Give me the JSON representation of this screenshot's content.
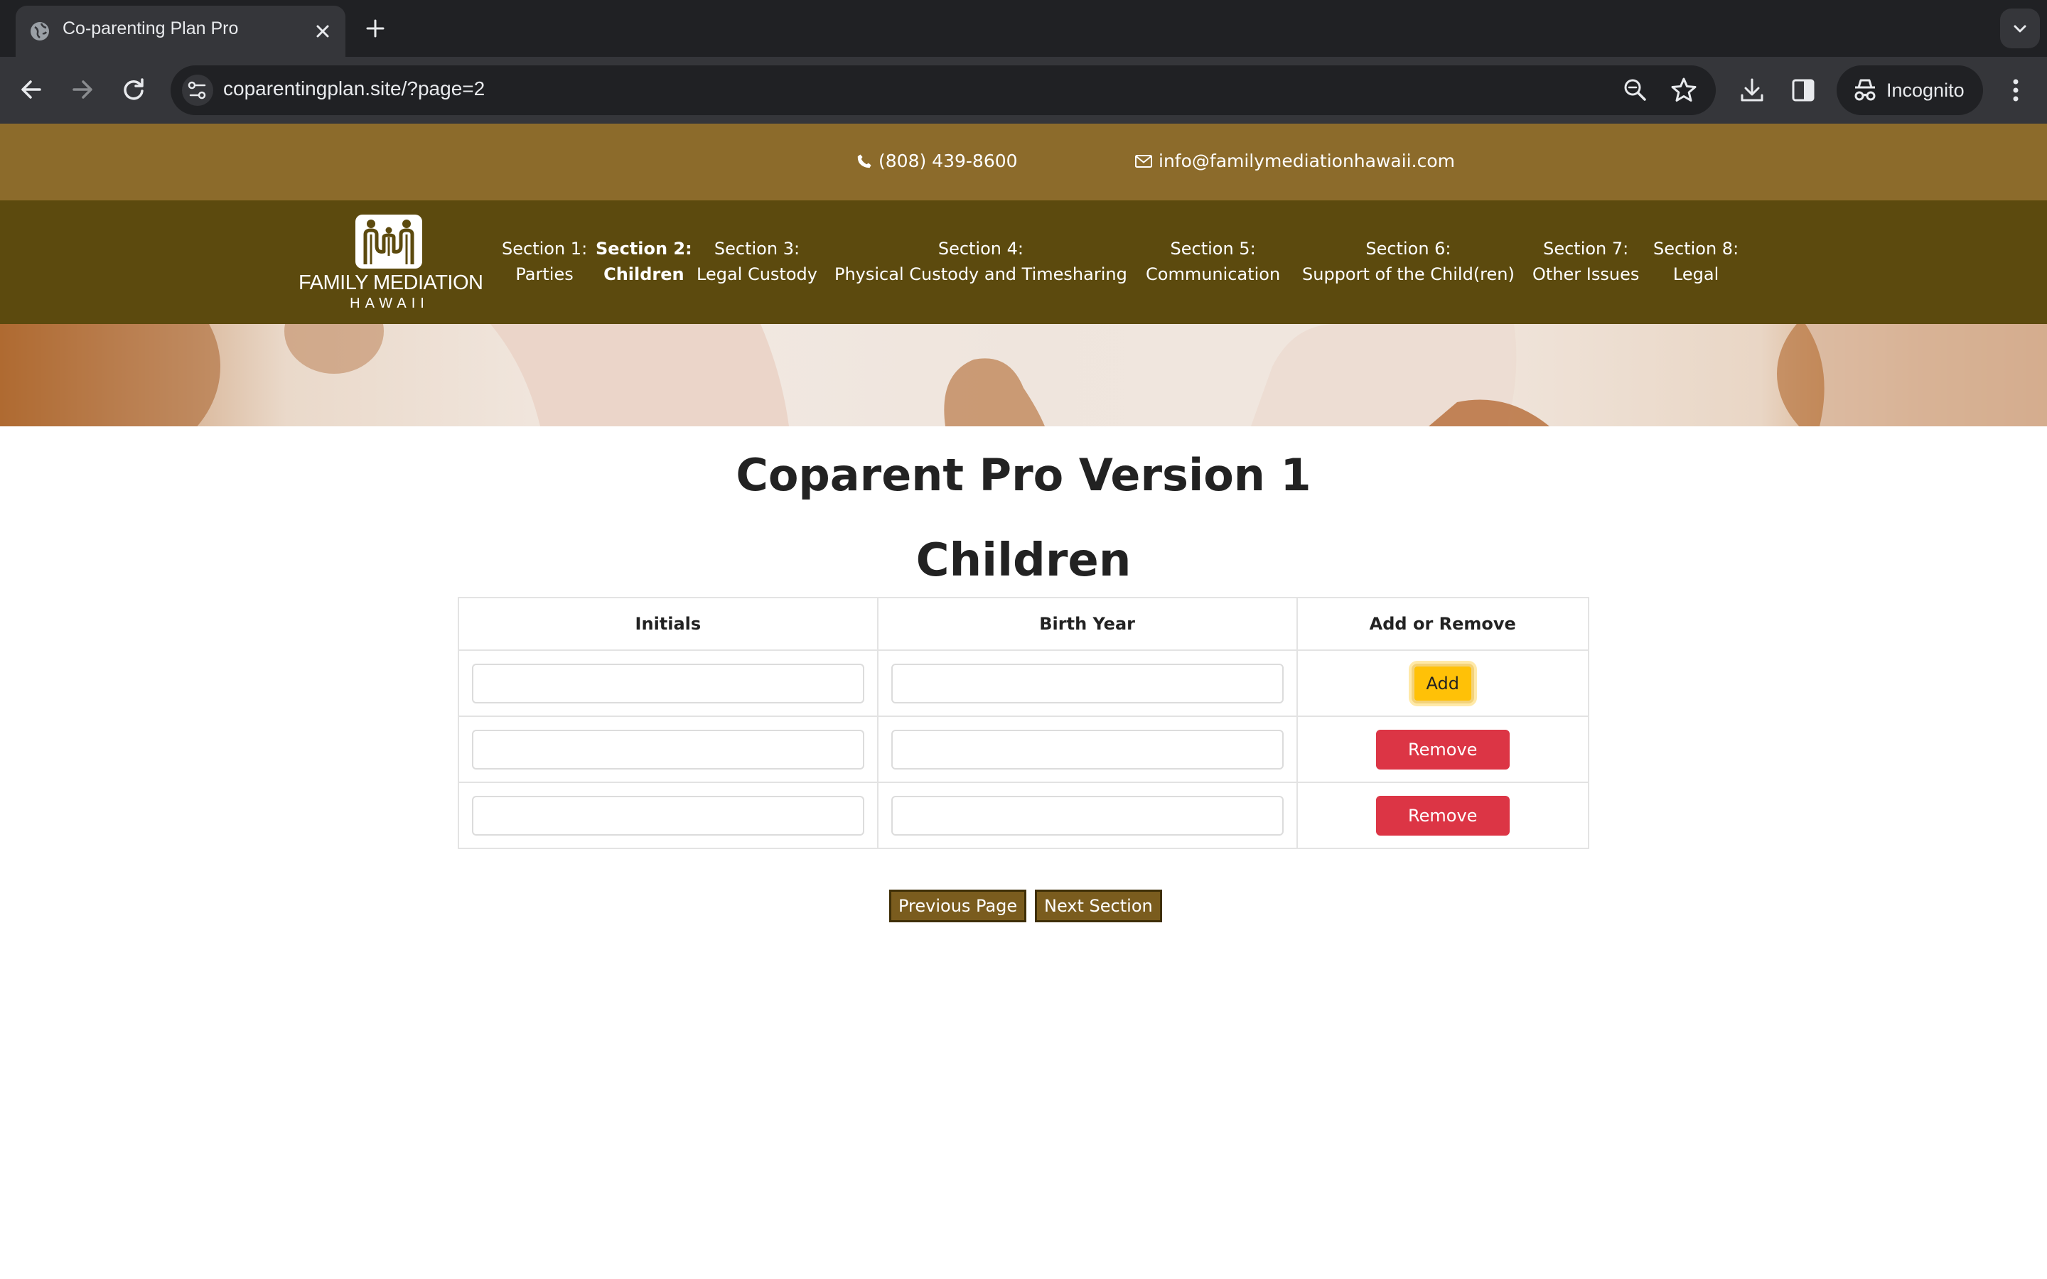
{
  "browser": {
    "tab_title": "Co-parenting Plan Pro",
    "url_host": "coparentingplan.site",
    "url_path": "/?page=2",
    "profile_label": "Incognito",
    "icons": {
      "favicon": "globe-icon",
      "close": "close-icon",
      "new_tab": "plus-icon",
      "tab_search": "chevron-down-icon",
      "back": "arrow-left-icon",
      "forward": "arrow-right-icon",
      "reload": "reload-icon",
      "site_info": "tune-icon",
      "zoom": "zoom-icon",
      "bookmark": "star-icon",
      "download": "download-icon",
      "side_panel": "side-panel-icon",
      "incognito": "incognito-icon",
      "menu": "kebab-menu-icon"
    }
  },
  "contact": {
    "phone": "(808) 439-8600",
    "email": "info@familymediationhawaii.com"
  },
  "logo": {
    "name": "FAMILY MEDIATION",
    "sub": "HAWAII"
  },
  "nav": {
    "items": [
      {
        "line1": "Section 1:",
        "line2": "Parties"
      },
      {
        "line1": "Section 2:",
        "line2": "Children"
      },
      {
        "line1": "Section 3:",
        "line2": "Legal Custody"
      },
      {
        "line1": "Section 4:",
        "line2": "Physical Custody and Timesharing"
      },
      {
        "line1": "Section 5:",
        "line2": "Communication"
      },
      {
        "line1": "Section 6:",
        "line2": "Support of the Child(ren)"
      },
      {
        "line1": "Section 7:",
        "line2": "Other Issues"
      },
      {
        "line1": "Section 8:",
        "line2": "Legal"
      }
    ],
    "active_index": 1
  },
  "main": {
    "title": "Coparent Pro Version 1",
    "section_title": "Children",
    "table": {
      "headers": [
        "Initials",
        "Birth Year",
        "Add or Remove"
      ],
      "rows": [
        {
          "initials": "",
          "birth_year": "",
          "action": "Add"
        },
        {
          "initials": "",
          "birth_year": "",
          "action": "Remove"
        },
        {
          "initials": "",
          "birth_year": "",
          "action": "Remove"
        }
      ]
    },
    "prev_label": "Previous Page",
    "next_label": "Next Section"
  },
  "colors": {
    "topbar": "#8c6b2b",
    "navbar": "#5c4a0e",
    "add_button": "#ffc107",
    "remove_button": "#dc3545",
    "pager_button": "#7a5c1e"
  }
}
